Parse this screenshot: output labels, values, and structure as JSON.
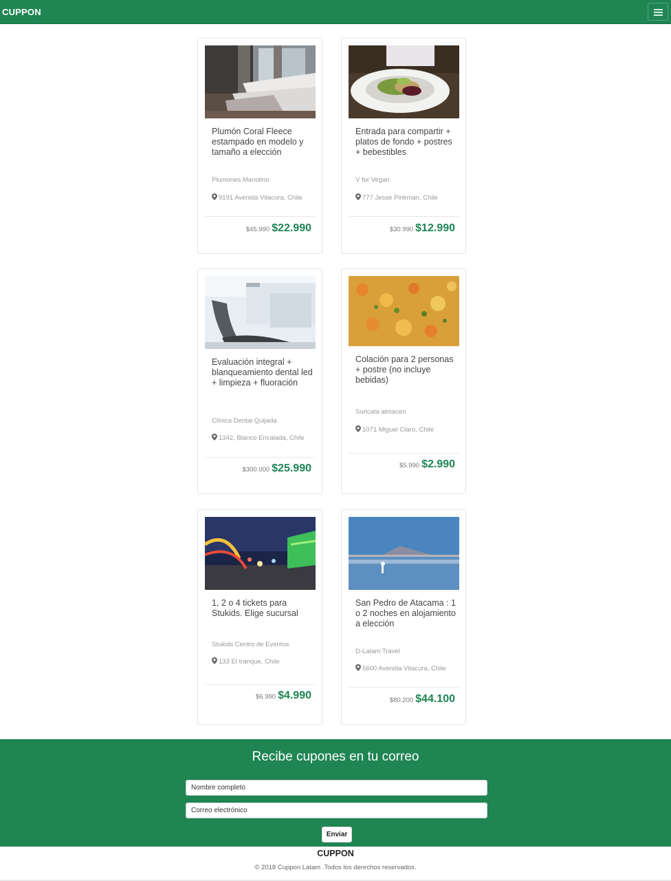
{
  "header": {
    "brand": "CUPPON",
    "menu_icon": "hamburger-icon"
  },
  "deals": [
    {
      "image": "bedroom-photo",
      "title": "Plumón Coral Fleece estampado en modelo y tamaño a elección",
      "merchant": "Plumones Manolino",
      "address": "9191 Avenida Vitacura, Chile",
      "old_price": "$45.990",
      "new_price": "$22.990"
    },
    {
      "image": "vegan-dish-photo",
      "title": "Entrada para compartir + platos de fondo + postres + bebestibles",
      "merchant": "V for Vegan",
      "address": "777 Jesse Pinkman, Chile",
      "old_price": "$30.990",
      "new_price": "$12.990"
    },
    {
      "image": "dental-clinic-photo",
      "title": "Evaluación integral + blanqueamiento dental led + limpieza + fluoración",
      "merchant": "Clínica Dental Quijada",
      "address": "1342, Blanco Encalada, Chile",
      "old_price": "$300.000",
      "new_price": "$25.990"
    },
    {
      "image": "food-plate-photo",
      "title": "Colación para 2 personas + postre (no incluye bebidas)",
      "merchant": "Suricata almacen",
      "address": "1071 Miguel Claro, Chile",
      "old_price": "$5.990",
      "new_price": "$2.990"
    },
    {
      "image": "amusement-park-photo",
      "title": "1, 2 o 4 tickets para Stukids. Elige sucursal",
      "merchant": "Stukids Centro de Eventos",
      "address": "133 El tranque, Chile",
      "old_price": "$6.990",
      "new_price": "$4.990"
    },
    {
      "image": "atacama-salt-flat-photo",
      "title": "San Pedro de Atacama : 1 o 2 noches en alojamiento a elección",
      "merchant": "D-Latam Travel",
      "address": "5600 Avenida Vitacura, Chile",
      "old_price": "$80.200",
      "new_price": "$44.100"
    }
  ],
  "newsletter": {
    "title": "Recibe cupones en tu correo",
    "name_placeholder": "Nombre completo",
    "email_placeholder": "Correo electrónico",
    "submit_label": "Enviar"
  },
  "footer": {
    "brand": "CUPPON",
    "copyright": "© 2018 Cuppon Latam .Todos los derechos reservados."
  },
  "colors": {
    "brand_green": "#1e8553",
    "price_green": "#1e8553"
  }
}
